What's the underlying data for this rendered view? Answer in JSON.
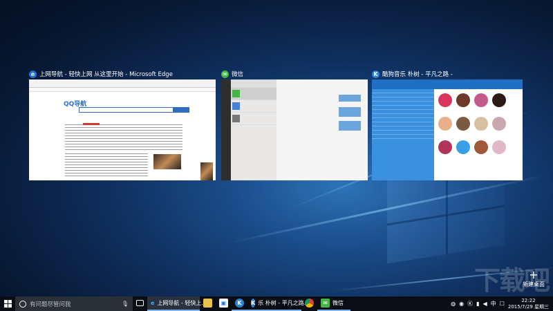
{
  "windows": [
    {
      "title": "上网导航 - 轻快上网 从这里开始 - Microsoft Edge",
      "icon": "edge-icon",
      "thumb_logo": "QQ导航"
    },
    {
      "title": "微信",
      "icon": "wechat-icon"
    },
    {
      "title": "酷狗音乐 朴树 - 平凡之路 -",
      "icon": "kugou-icon"
    }
  ],
  "new_desktop": {
    "label": "新建桌面",
    "icon": "plus-icon"
  },
  "watermark": "下载吧",
  "taskbar": {
    "search_placeholder": "有问题尽管问我",
    "buttons": [
      {
        "label": "上网导航 - 轻快上...",
        "icon": "edge-icon"
      },
      {
        "label": "",
        "icon": "file-explorer-icon"
      },
      {
        "label": "",
        "icon": "store-icon"
      },
      {
        "label": "",
        "icon": "kugou-icon"
      },
      {
        "label": "乐 朴树 - 平凡之路...",
        "icon": "kugou-icon"
      },
      {
        "label": "",
        "icon": "chrome-icon"
      },
      {
        "label": "微信",
        "icon": "wechat-icon"
      }
    ],
    "time": "22:22",
    "date": "2015/7/29 星期三"
  },
  "colors": {
    "taskbar": "#0a0e14",
    "accent": "#7fb6ee",
    "edge": "#1e73d4",
    "wechat": "#47b34a",
    "kugou": "#2c83d6"
  }
}
